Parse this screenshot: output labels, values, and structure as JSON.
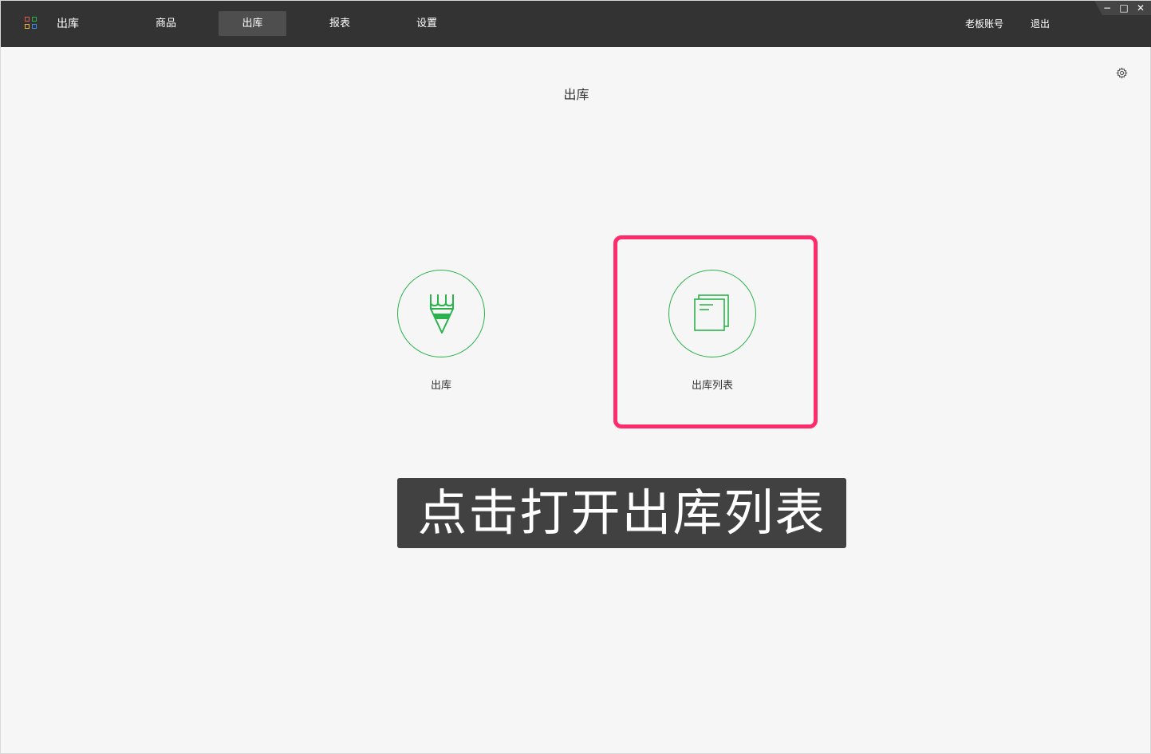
{
  "app": {
    "title": "出库",
    "logo_icon": "app-grid-icon",
    "logo_colors": [
      "#e8574b",
      "#2bb24c",
      "#f0b83a",
      "#3a8ee6"
    ]
  },
  "nav": {
    "items": [
      {
        "label": "商品",
        "active": false
      },
      {
        "label": "出库",
        "active": true
      },
      {
        "label": "报表",
        "active": false
      },
      {
        "label": "设置",
        "active": false
      }
    ]
  },
  "account": {
    "boss_account_label": "老板账号",
    "logout_label": "退出"
  },
  "window_controls": {
    "minimize": "−",
    "maximize": "□",
    "close": "✕"
  },
  "page": {
    "title": "出库",
    "settings_icon": "gear-icon"
  },
  "tiles": [
    {
      "label": "出库",
      "icon": "pencil-icon"
    },
    {
      "label": "出库列表",
      "icon": "document-list-icon"
    }
  ],
  "overlay": {
    "caption": "点击打开出库列表",
    "highlight_color": "#fe2c6b"
  },
  "colors": {
    "topbar": "#333333",
    "accent_green": "#2bb24c",
    "page_bg": "#f6f6f6"
  }
}
